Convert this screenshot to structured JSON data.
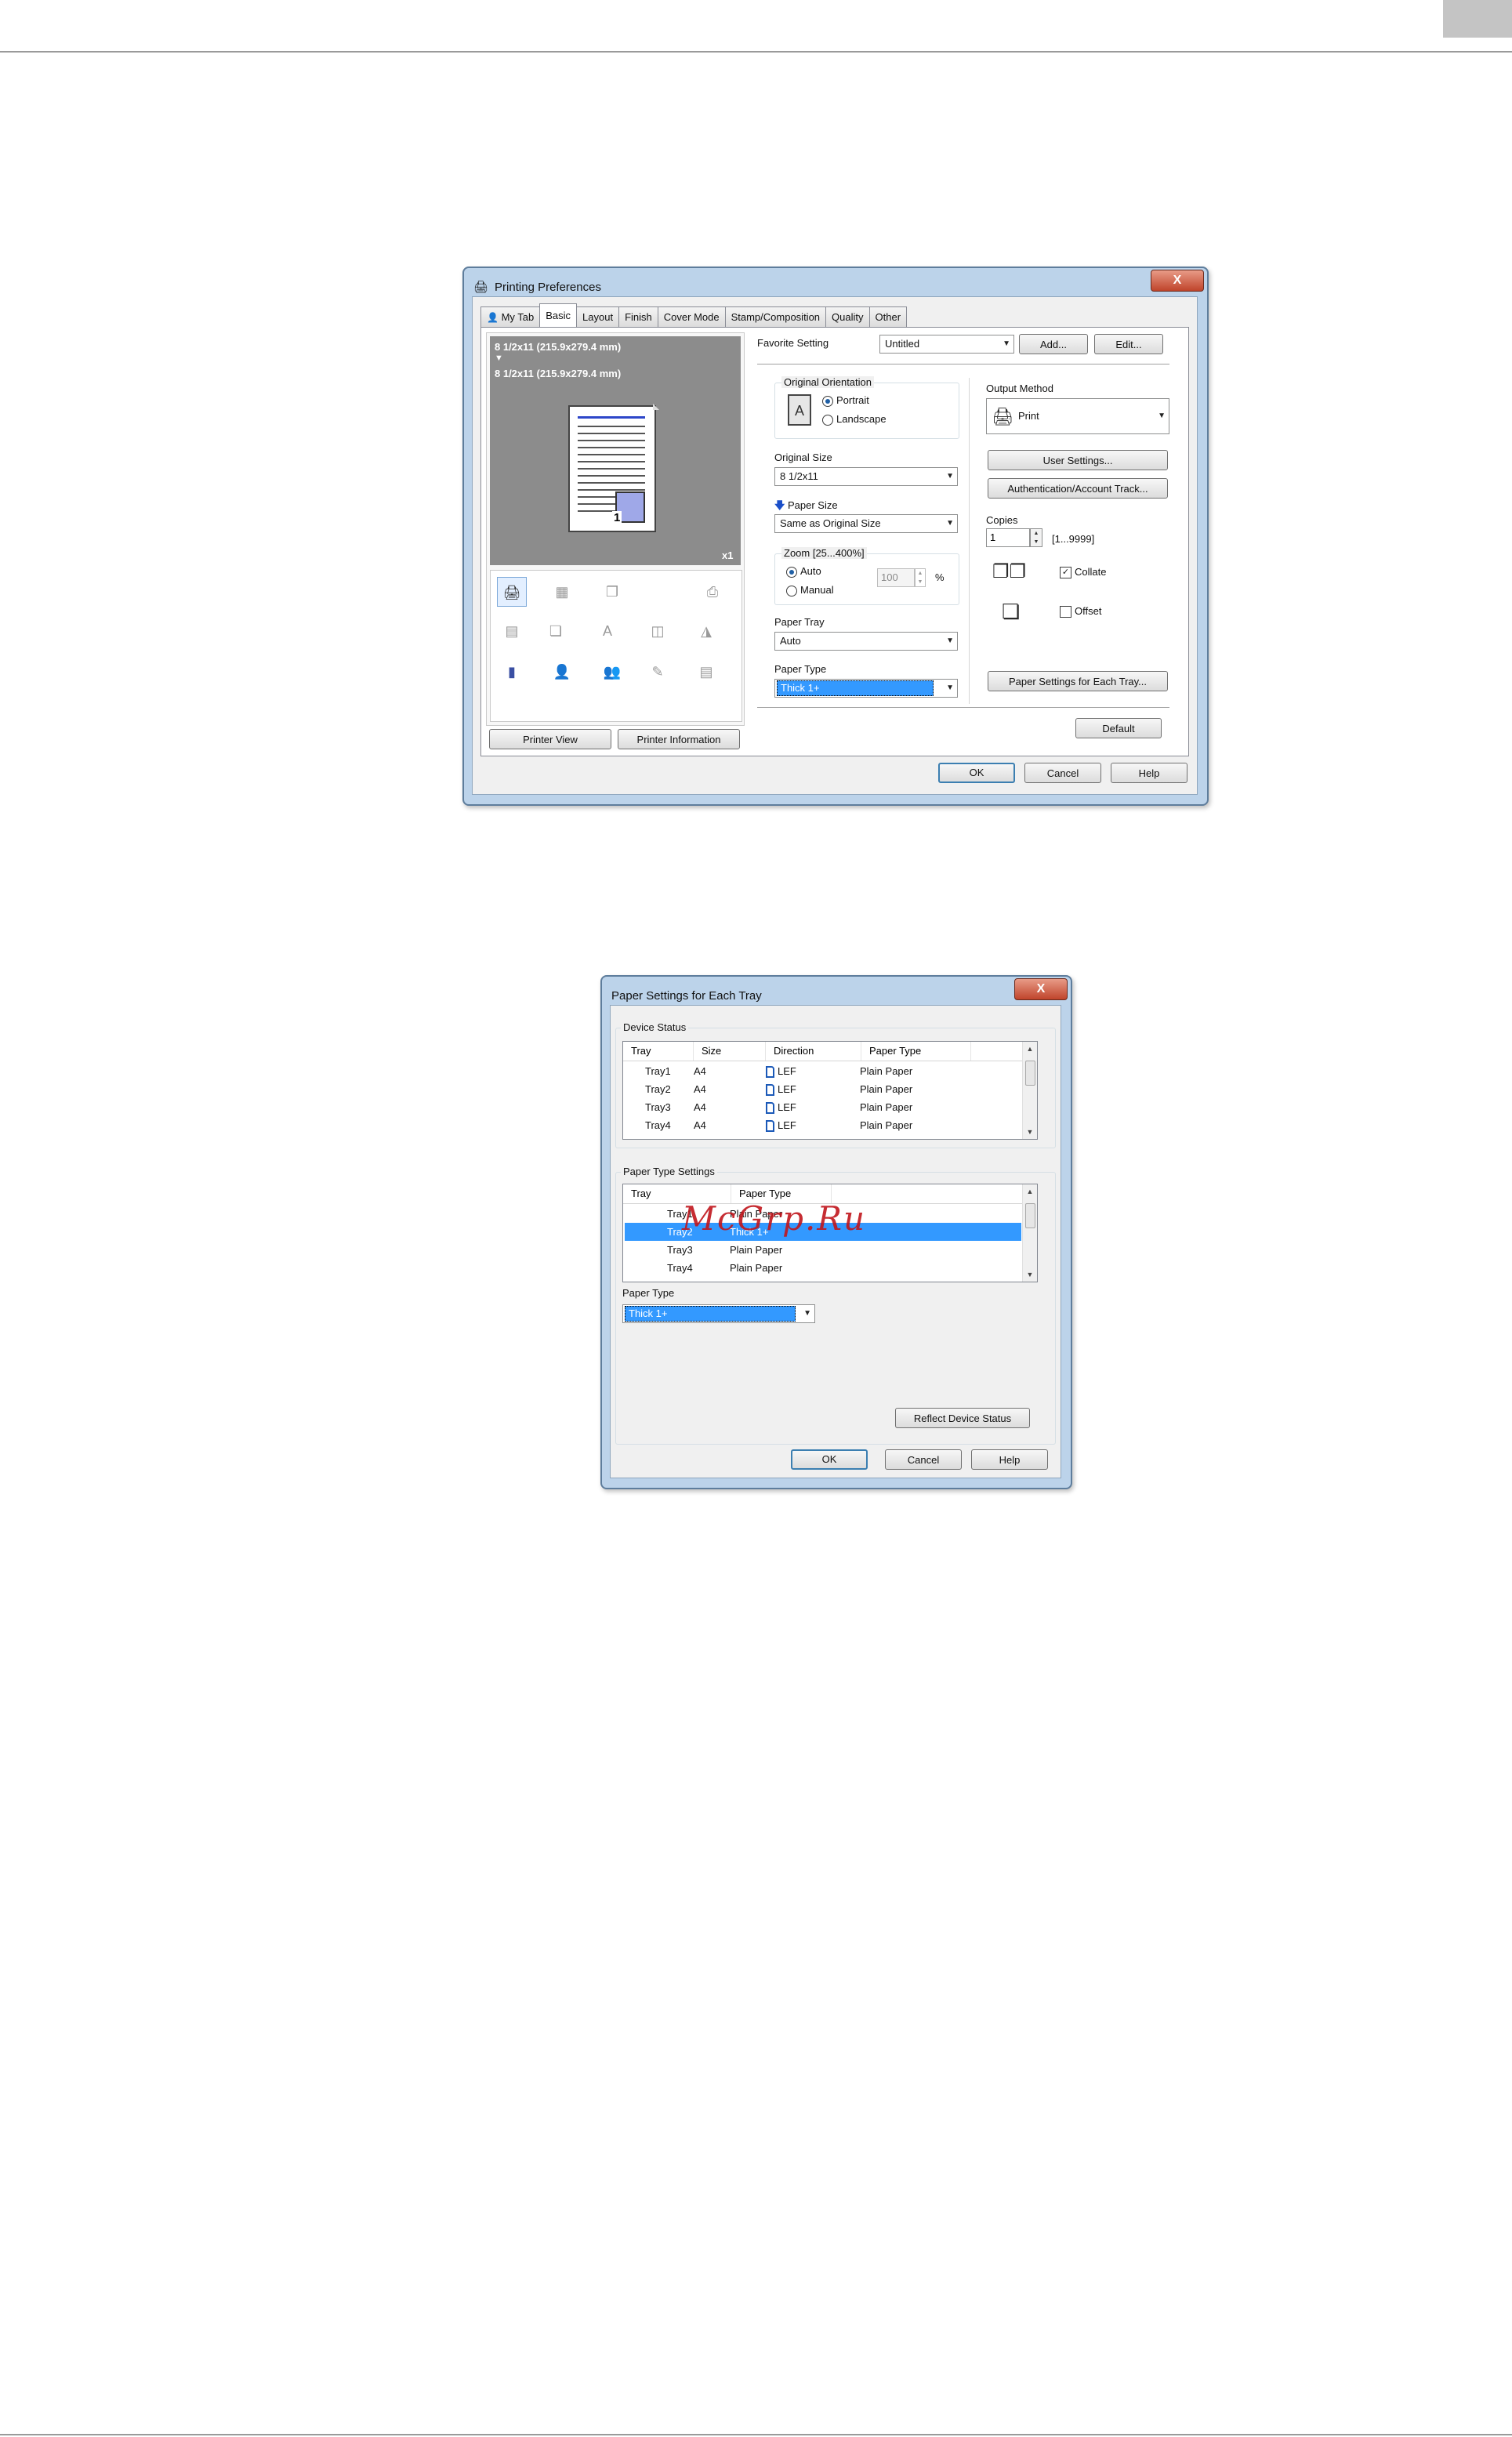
{
  "page": {
    "corner_color": "#c4c4c4"
  },
  "dialog1": {
    "title": "Printing Preferences",
    "close": "X",
    "tabs": [
      "My Tab",
      "Basic",
      "Layout",
      "Finish",
      "Cover Mode",
      "Stamp/Composition",
      "Quality",
      "Other"
    ],
    "active_tab": "Basic",
    "preview": {
      "line1": "8 1/2x11 (215.9x279.4 mm)",
      "arrow": "▼",
      "line2": "8 1/2x11 (215.9x279.4 mm)",
      "count": "x1",
      "page_number": "1"
    },
    "printer_view": "Printer View",
    "printer_information": "Printer Information",
    "favorite_setting": {
      "label": "Favorite Setting",
      "value": "Untitled",
      "add": "Add...",
      "edit": "Edit..."
    },
    "original_orientation": {
      "label": "Original Orientation",
      "portrait": "Portrait",
      "landscape": "Landscape"
    },
    "original_size": {
      "label": "Original Size",
      "value": "8 1/2x11"
    },
    "paper_size": {
      "label": "Paper Size",
      "value": "Same as Original Size"
    },
    "zoom": {
      "label": "Zoom [25...400%]",
      "auto": "Auto",
      "manual": "Manual",
      "value": "100",
      "unit": "%"
    },
    "paper_tray": {
      "label": "Paper Tray",
      "value": "Auto"
    },
    "paper_type": {
      "label": "Paper Type",
      "value": "Thick 1+"
    },
    "output_method": {
      "label": "Output Method",
      "value": "Print"
    },
    "user_settings": "User Settings...",
    "authentication": "Authentication/Account Track...",
    "copies": {
      "label": "Copies",
      "value": "1",
      "range": "[1...9999]"
    },
    "collate": "Collate",
    "offset": "Offset",
    "paper_settings_each_tray": "Paper Settings for Each Tray...",
    "default": "Default",
    "ok": "OK",
    "cancel": "Cancel",
    "help": "Help"
  },
  "dialog2": {
    "title": "Paper Settings for Each Tray",
    "close": "X",
    "device_status": {
      "label": "Device Status",
      "columns": [
        "Tray",
        "Size",
        "Direction",
        "Paper Type"
      ],
      "rows": [
        {
          "tray": "Tray1",
          "size": "A4",
          "direction": "LEF",
          "type": "Plain Paper"
        },
        {
          "tray": "Tray2",
          "size": "A4",
          "direction": "LEF",
          "type": "Plain Paper"
        },
        {
          "tray": "Tray3",
          "size": "A4",
          "direction": "LEF",
          "type": "Plain Paper"
        },
        {
          "tray": "Tray4",
          "size": "A4",
          "direction": "LEF",
          "type": "Plain Paper"
        }
      ]
    },
    "paper_type_settings": {
      "label": "Paper Type Settings",
      "columns": [
        "Tray",
        "Paper Type"
      ],
      "rows": [
        {
          "tray": "Tray1",
          "type": "Plain Paper"
        },
        {
          "tray": "Tray2",
          "type": "Thick 1+"
        },
        {
          "tray": "Tray3",
          "type": "Plain Paper"
        },
        {
          "tray": "Tray4",
          "type": "Plain Paper"
        }
      ]
    },
    "paper_type": {
      "label": "Paper Type",
      "value": "Thick 1+"
    },
    "reflect_device_status": "Reflect Device Status",
    "ok": "OK",
    "cancel": "Cancel",
    "help": "Help"
  },
  "watermark": "McGrp.Ru"
}
